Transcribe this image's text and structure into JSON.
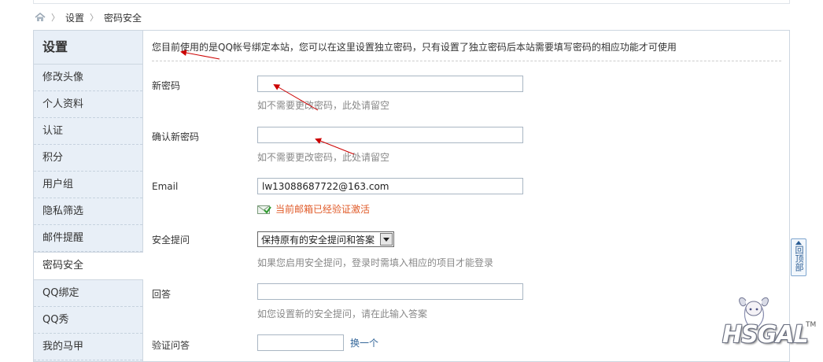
{
  "breadcrumb": {
    "items": [
      "设置",
      "密码安全"
    ]
  },
  "sidebar": {
    "title": "设置",
    "items": [
      {
        "label": "修改头像"
      },
      {
        "label": "个人资料"
      },
      {
        "label": "认证"
      },
      {
        "label": "积分"
      },
      {
        "label": "用户组"
      },
      {
        "label": "隐私筛选"
      },
      {
        "label": "邮件提醒"
      },
      {
        "label": "密码安全"
      },
      {
        "label": "QQ绑定"
      },
      {
        "label": "QQ秀"
      },
      {
        "label": "我的马甲"
      }
    ],
    "active_index": 7
  },
  "form": {
    "notice": "您目前使用的是QQ帐号绑定本站，您可以在这里设置独立密码，只有设置了独立密码后本站需要填写密码的相应功能才可使用",
    "new_password": {
      "label": "新密码",
      "value": "",
      "hint": "如不需要更改密码，此处请留空"
    },
    "confirm_password": {
      "label": "确认新密码",
      "value": "",
      "hint": "如不需要更改密码，此处请留空"
    },
    "email": {
      "label": "Email",
      "value": "lw13088687722@163.com",
      "status": "当前邮箱已经验证激活"
    },
    "security_question": {
      "label": "安全提问",
      "selected": "保持原有的安全提问和答案",
      "hint": "如果您启用安全提问，登录时需填入相应的项目才能登录"
    },
    "answer": {
      "label": "回答",
      "value": "",
      "hint": "如您设置新的安全提问，请在此输入答案"
    },
    "captcha": {
      "label": "验证问答",
      "value": "",
      "swap_link": "换一个"
    }
  },
  "back_to_top": "回顶部",
  "watermark": {
    "text": "HSGAL",
    "tm": "TM"
  },
  "colors": {
    "sidebar_bg": "#e8eff7",
    "border": "#cdd6e0",
    "verified_text": "#e05a28",
    "link": "#336699",
    "annotation_arrow": "#cc0000"
  }
}
